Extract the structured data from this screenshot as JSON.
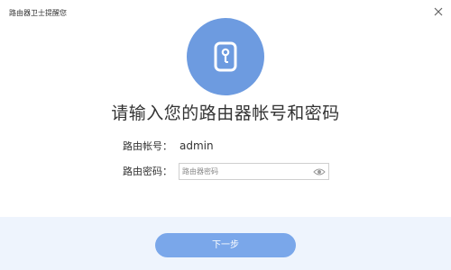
{
  "window": {
    "title": "路由器卫士提醒您"
  },
  "main": {
    "heading": "请输入您的路由器帐号和密码",
    "account_label": "路由帐号：",
    "account_value": "admin",
    "password_label": "路由密码：",
    "password_placeholder": "路由器密码",
    "password_value": ""
  },
  "footer": {
    "next_label": "下一步"
  },
  "icons": {
    "close": "close-icon",
    "lock": "lock-icon",
    "eye": "eye-icon"
  },
  "colors": {
    "accent": "#6d9be0",
    "button": "#7aa7ea",
    "footer_bg": "#eef4fd"
  }
}
